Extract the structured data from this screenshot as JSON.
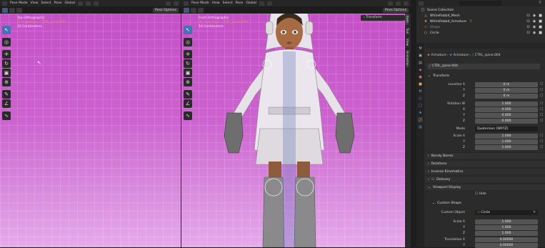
{
  "left_header": {
    "mode": "Pose Mode",
    "menus": [
      "View",
      "Select",
      "Pose"
    ],
    "orientation": "Global",
    "pose_options": "Pose Options"
  },
  "mid_header": {
    "mode": "Pose Mode",
    "menus": [
      "View",
      "Select",
      "Pose"
    ],
    "orientation": "Global",
    "pose_options": "Pose Options"
  },
  "left_viewport": {
    "title": "Top Orthographic",
    "line2": "(0) Armature : CTRL_spine.004",
    "line3": "10 Centimeters"
  },
  "mid_viewport": {
    "title": "Front Orthographic",
    "line2": "(0) Armature : CTRL_spine.004",
    "line3": "10 Centimeters",
    "transform_panel": "Transform"
  },
  "side_tabs": [
    "Item",
    "Tool",
    "View",
    "Animation"
  ],
  "outliner": {
    "collection": "Scene Collection",
    "items": [
      {
        "label": "WhiteRabbit_Mesh",
        "icon": "mesh-icon"
      },
      {
        "label": "WhiteRabbit_Armature",
        "icon": "armature-icon"
      },
      {
        "label": "Shape",
        "icon": "empty-icon"
      },
      {
        "label": "Circle",
        "icon": "curve-icon"
      }
    ]
  },
  "properties": {
    "breadcrumb": [
      "Armature",
      "Armature",
      "CTRL_spine.004"
    ],
    "bone_name": "CTRL_spine.004",
    "transform_header": "Transform",
    "location": {
      "label_x": "Location X",
      "y": "Y",
      "z": "Z",
      "values": [
        "0 m",
        "0 m",
        "0 m"
      ]
    },
    "rotation": {
      "label_w": "Rotation W",
      "x": "X",
      "y": "Y",
      "z": "Z",
      "values": [
        "1.000",
        "0.000",
        "0.000",
        "0.000"
      ]
    },
    "mode": {
      "label": "Mode",
      "value": "Quaternion (WXYZ)"
    },
    "scale": {
      "label_x": "Scale X",
      "y": "Y",
      "z": "Z",
      "values": [
        "1.000",
        "1.000",
        "1.000"
      ]
    },
    "sections": [
      "Bendy Bones",
      "Relations",
      "Inverse Kinematics",
      "Delivery",
      "Viewport Display"
    ],
    "hide_label": "Hide",
    "custom_shape": {
      "header": "Custom Shape",
      "object_label": "Custom Object",
      "object_value": "Circle",
      "scale_label_x": "Scale X",
      "y": "Y",
      "z": "Z",
      "scale_values": [
        "1.000",
        "1.000",
        "1.000"
      ],
      "translation_label_x": "Translation X",
      "translation_y": "Y",
      "translation_values": [
        "0.00000",
        "0.00000"
      ]
    }
  },
  "colors": {
    "viewport_top": "#c550c7",
    "viewport_bottom": "#e6aaea",
    "accent": "#4772b3",
    "origin": "#e09a3c"
  }
}
